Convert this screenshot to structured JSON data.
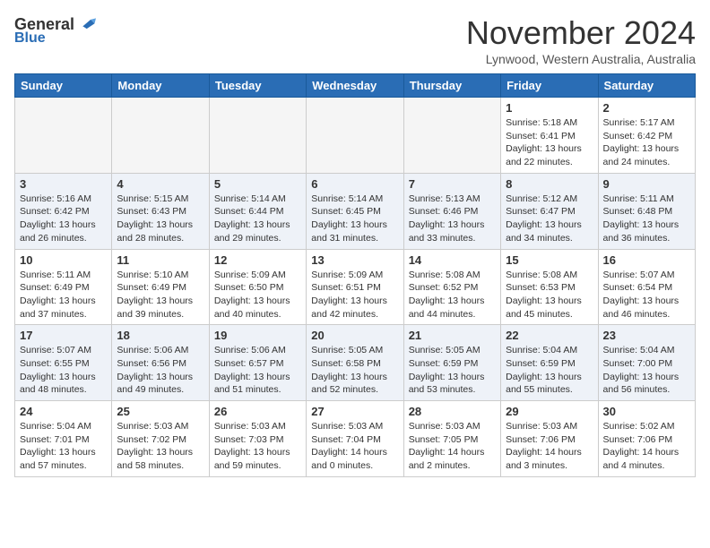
{
  "header": {
    "logo_general": "General",
    "logo_blue": "Blue",
    "month_title": "November 2024",
    "location": "Lynwood, Western Australia, Australia"
  },
  "days_of_week": [
    "Sunday",
    "Monday",
    "Tuesday",
    "Wednesday",
    "Thursday",
    "Friday",
    "Saturday"
  ],
  "weeks": [
    [
      {
        "day": "",
        "info": ""
      },
      {
        "day": "",
        "info": ""
      },
      {
        "day": "",
        "info": ""
      },
      {
        "day": "",
        "info": ""
      },
      {
        "day": "",
        "info": ""
      },
      {
        "day": "1",
        "info": "Sunrise: 5:18 AM\nSunset: 6:41 PM\nDaylight: 13 hours\nand 22 minutes."
      },
      {
        "day": "2",
        "info": "Sunrise: 5:17 AM\nSunset: 6:42 PM\nDaylight: 13 hours\nand 24 minutes."
      }
    ],
    [
      {
        "day": "3",
        "info": "Sunrise: 5:16 AM\nSunset: 6:42 PM\nDaylight: 13 hours\nand 26 minutes."
      },
      {
        "day": "4",
        "info": "Sunrise: 5:15 AM\nSunset: 6:43 PM\nDaylight: 13 hours\nand 28 minutes."
      },
      {
        "day": "5",
        "info": "Sunrise: 5:14 AM\nSunset: 6:44 PM\nDaylight: 13 hours\nand 29 minutes."
      },
      {
        "day": "6",
        "info": "Sunrise: 5:14 AM\nSunset: 6:45 PM\nDaylight: 13 hours\nand 31 minutes."
      },
      {
        "day": "7",
        "info": "Sunrise: 5:13 AM\nSunset: 6:46 PM\nDaylight: 13 hours\nand 33 minutes."
      },
      {
        "day": "8",
        "info": "Sunrise: 5:12 AM\nSunset: 6:47 PM\nDaylight: 13 hours\nand 34 minutes."
      },
      {
        "day": "9",
        "info": "Sunrise: 5:11 AM\nSunset: 6:48 PM\nDaylight: 13 hours\nand 36 minutes."
      }
    ],
    [
      {
        "day": "10",
        "info": "Sunrise: 5:11 AM\nSunset: 6:49 PM\nDaylight: 13 hours\nand 37 minutes."
      },
      {
        "day": "11",
        "info": "Sunrise: 5:10 AM\nSunset: 6:49 PM\nDaylight: 13 hours\nand 39 minutes."
      },
      {
        "day": "12",
        "info": "Sunrise: 5:09 AM\nSunset: 6:50 PM\nDaylight: 13 hours\nand 40 minutes."
      },
      {
        "day": "13",
        "info": "Sunrise: 5:09 AM\nSunset: 6:51 PM\nDaylight: 13 hours\nand 42 minutes."
      },
      {
        "day": "14",
        "info": "Sunrise: 5:08 AM\nSunset: 6:52 PM\nDaylight: 13 hours\nand 44 minutes."
      },
      {
        "day": "15",
        "info": "Sunrise: 5:08 AM\nSunset: 6:53 PM\nDaylight: 13 hours\nand 45 minutes."
      },
      {
        "day": "16",
        "info": "Sunrise: 5:07 AM\nSunset: 6:54 PM\nDaylight: 13 hours\nand 46 minutes."
      }
    ],
    [
      {
        "day": "17",
        "info": "Sunrise: 5:07 AM\nSunset: 6:55 PM\nDaylight: 13 hours\nand 48 minutes."
      },
      {
        "day": "18",
        "info": "Sunrise: 5:06 AM\nSunset: 6:56 PM\nDaylight: 13 hours\nand 49 minutes."
      },
      {
        "day": "19",
        "info": "Sunrise: 5:06 AM\nSunset: 6:57 PM\nDaylight: 13 hours\nand 51 minutes."
      },
      {
        "day": "20",
        "info": "Sunrise: 5:05 AM\nSunset: 6:58 PM\nDaylight: 13 hours\nand 52 minutes."
      },
      {
        "day": "21",
        "info": "Sunrise: 5:05 AM\nSunset: 6:59 PM\nDaylight: 13 hours\nand 53 minutes."
      },
      {
        "day": "22",
        "info": "Sunrise: 5:04 AM\nSunset: 6:59 PM\nDaylight: 13 hours\nand 55 minutes."
      },
      {
        "day": "23",
        "info": "Sunrise: 5:04 AM\nSunset: 7:00 PM\nDaylight: 13 hours\nand 56 minutes."
      }
    ],
    [
      {
        "day": "24",
        "info": "Sunrise: 5:04 AM\nSunset: 7:01 PM\nDaylight: 13 hours\nand 57 minutes."
      },
      {
        "day": "25",
        "info": "Sunrise: 5:03 AM\nSunset: 7:02 PM\nDaylight: 13 hours\nand 58 minutes."
      },
      {
        "day": "26",
        "info": "Sunrise: 5:03 AM\nSunset: 7:03 PM\nDaylight: 13 hours\nand 59 minutes."
      },
      {
        "day": "27",
        "info": "Sunrise: 5:03 AM\nSunset: 7:04 PM\nDaylight: 14 hours\nand 0 minutes."
      },
      {
        "day": "28",
        "info": "Sunrise: 5:03 AM\nSunset: 7:05 PM\nDaylight: 14 hours\nand 2 minutes."
      },
      {
        "day": "29",
        "info": "Sunrise: 5:03 AM\nSunset: 7:06 PM\nDaylight: 14 hours\nand 3 minutes."
      },
      {
        "day": "30",
        "info": "Sunrise: 5:02 AM\nSunset: 7:06 PM\nDaylight: 14 hours\nand 4 minutes."
      }
    ]
  ]
}
